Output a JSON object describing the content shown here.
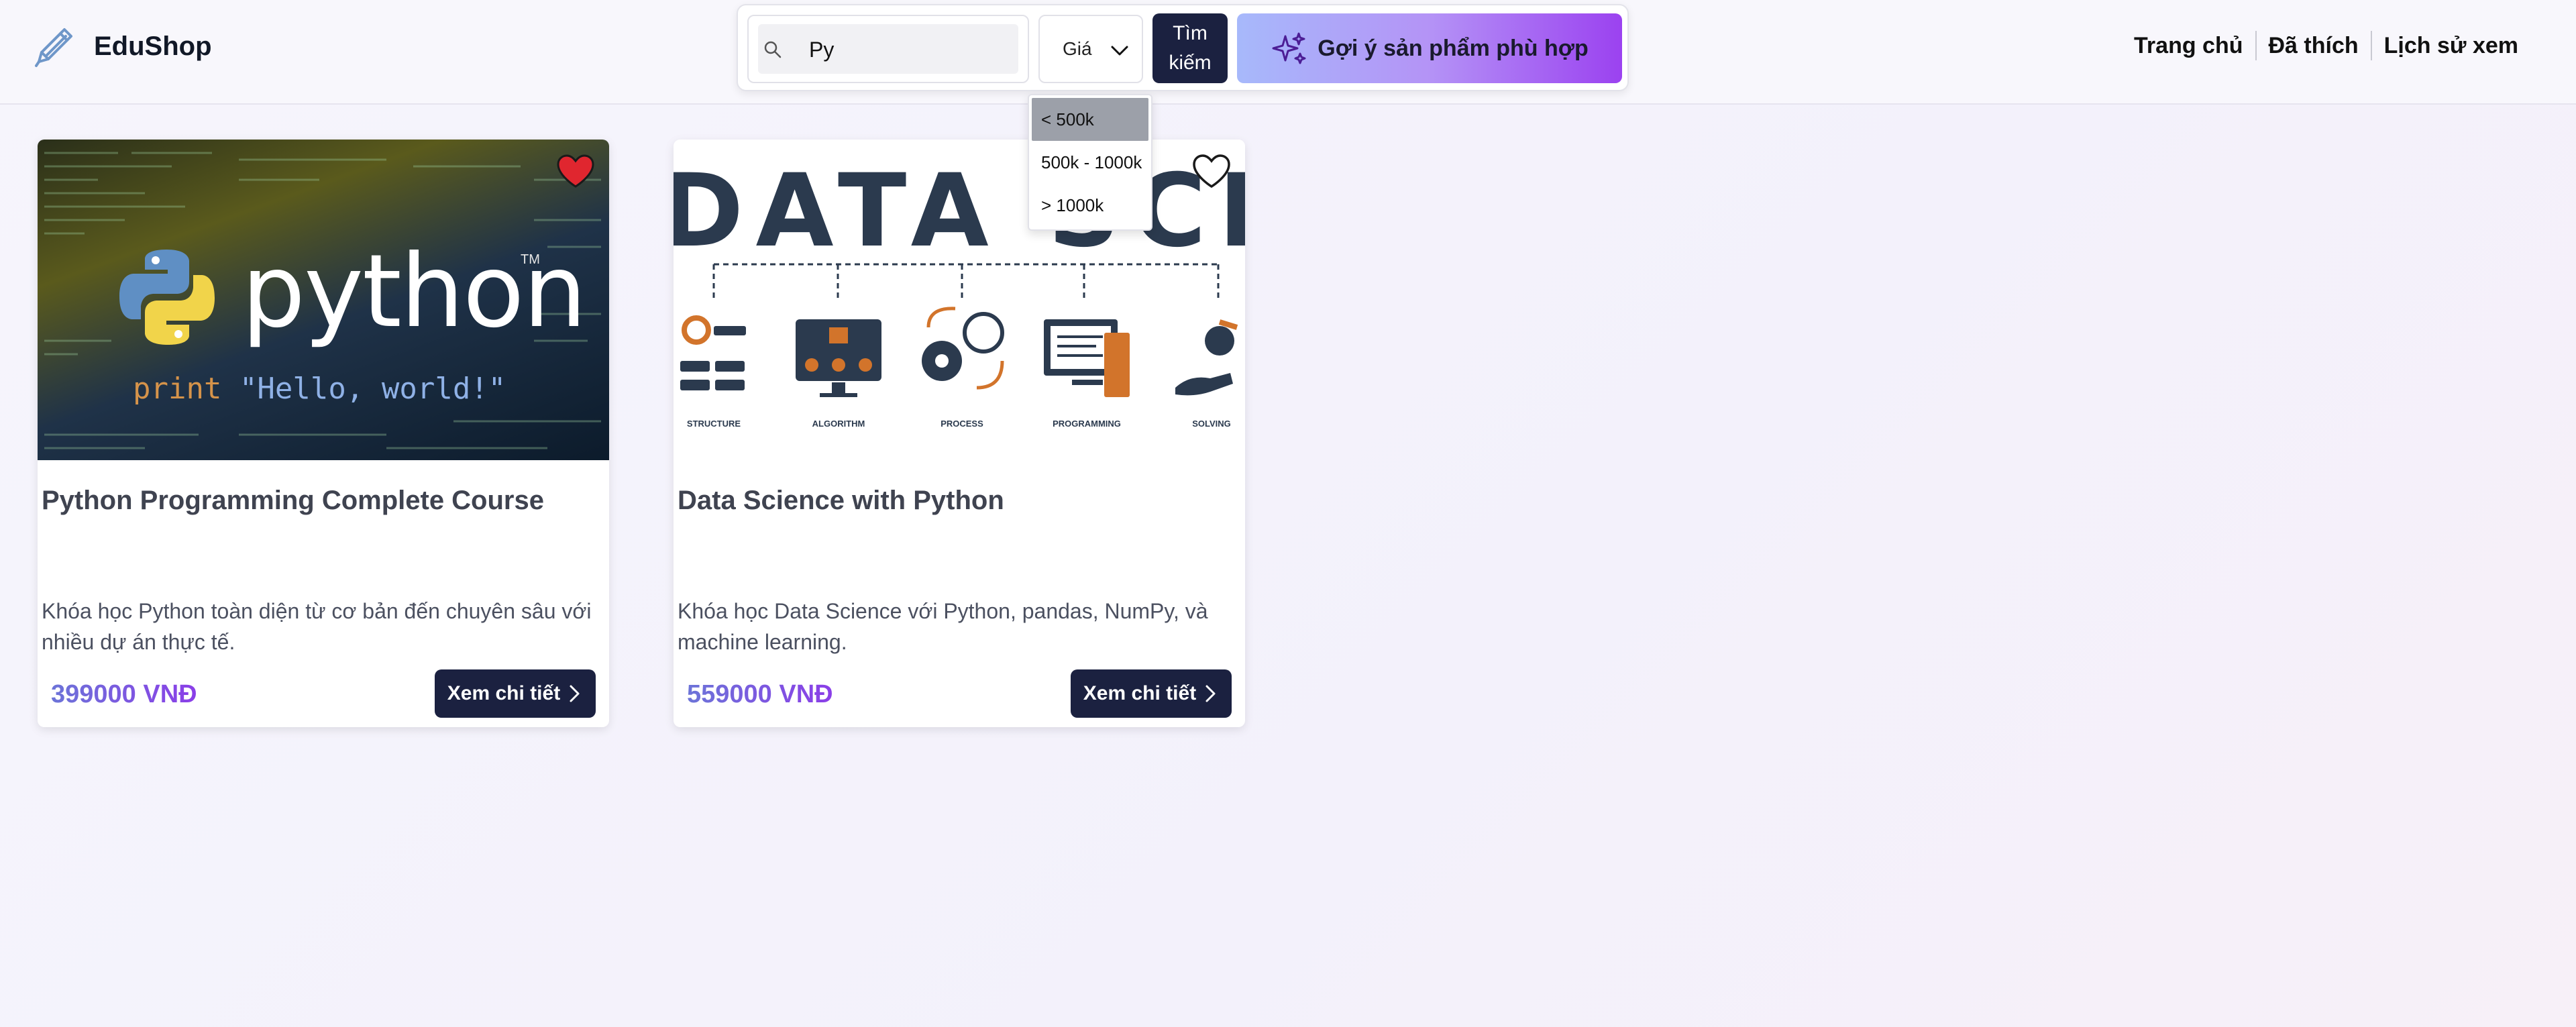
{
  "app": {
    "name": "EduShop"
  },
  "search": {
    "value": "Py",
    "price_filter_label": "Giá",
    "search_button_label": "Tìm kiếm",
    "suggest_button_label": "Gợi ý sản phẩm phù hợp"
  },
  "nav": {
    "items": [
      {
        "label": "Trang chủ"
      },
      {
        "label": "Đã thích"
      },
      {
        "label": "Lịch sử xem"
      }
    ]
  },
  "price_dropdown": {
    "options": [
      {
        "label": "< 500k",
        "selected": true
      },
      {
        "label": "500k - 1000k",
        "selected": false
      },
      {
        "label": "> 1000k",
        "selected": false
      }
    ]
  },
  "products": [
    {
      "title": "Python Programming Complete Course",
      "description": "Khóa học Python toàn diện từ cơ bản đến chuyên sâu với nhiều dự án thực tế.",
      "price": "399000 VNĐ",
      "liked": true,
      "detail_button_label": "Xem chi tiết",
      "image": {
        "wordmark": "python",
        "tm": "TM",
        "code_keyword": "print",
        "code_string": " \"Hello, world!\""
      }
    },
    {
      "title": "Data Science with Python",
      "description": "Khóa học Data Science với Python, pandas, NumPy, và machine learning.",
      "price": "559000 VNĐ",
      "liked": false,
      "detail_button_label": "Xem chi tiết",
      "image": {
        "heading": "DATA SCIENCE",
        "labels": [
          "STRUCTURE",
          "ALGORITHM",
          "PROCESS",
          "PROGRAMMING",
          "SOLVING"
        ]
      }
    }
  ],
  "colors": {
    "primary_dark": "#1b2140",
    "heart_liked": "#e0262f",
    "accent_gradient_start": "#a7b9fb",
    "accent_gradient_end": "#9b42f0"
  }
}
